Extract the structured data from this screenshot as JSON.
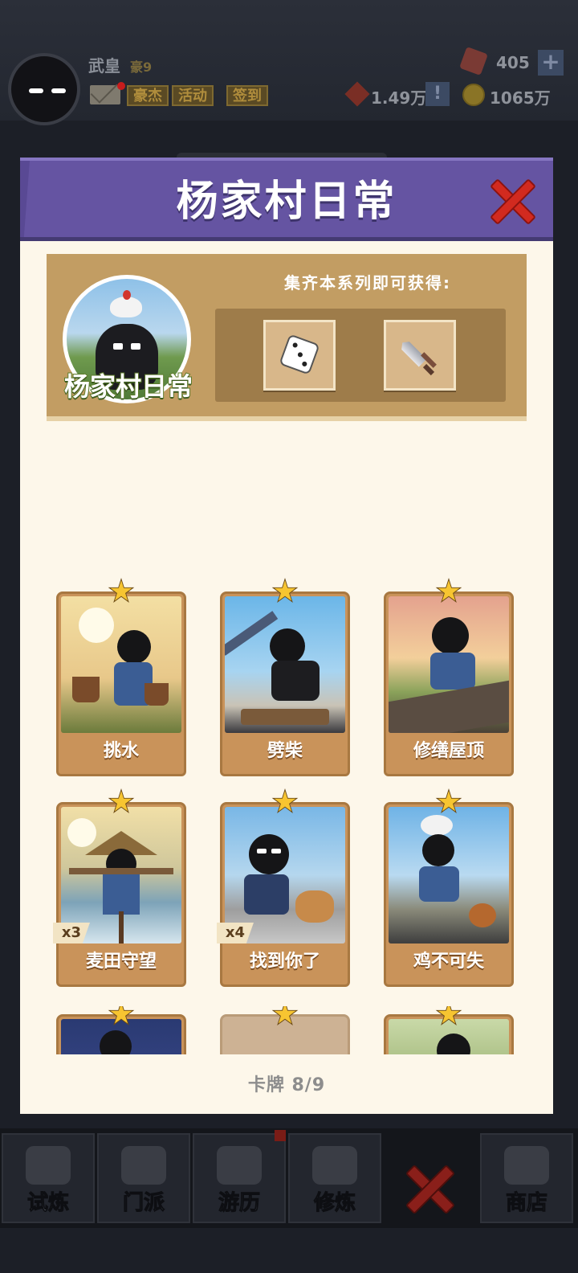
{
  "hud": {
    "player_name": "武皇",
    "player_rank": "豪9",
    "buttons": [
      "豪杰",
      "活动",
      "签到"
    ],
    "gems": "405",
    "plus": "+",
    "tokens": "1.49万",
    "alert": "!",
    "gold": "1065万"
  },
  "modal": {
    "title": "杨家村日常",
    "series_name": "杨家村日常",
    "reward_caption": "集齐本系列即可获得:",
    "rewards": [
      {
        "icon": "dice-icon"
      },
      {
        "icon": "sword-icon"
      }
    ],
    "cards": [
      {
        "name": "挑水",
        "count": ""
      },
      {
        "name": "劈柴",
        "count": ""
      },
      {
        "name": "修缮屋顶",
        "count": ""
      },
      {
        "name": "麦田守望",
        "count": "x3"
      },
      {
        "name": "找到你了",
        "count": "x4"
      },
      {
        "name": "鸡不可失",
        "count": ""
      },
      {
        "name": "",
        "count": ""
      },
      {
        "name": "",
        "count": ""
      },
      {
        "name": "",
        "count": ""
      }
    ],
    "counter": "卡牌  8/9"
  },
  "nav": {
    "items": [
      "试炼",
      "门派",
      "游历",
      "修炼",
      "",
      "商店"
    ]
  },
  "colors": {
    "header_purple": "#6554a2",
    "close_red": "#d22a1f",
    "panel_tan": "#c29d63",
    "card_tan": "#c9935a",
    "star_gold": "#f7c531",
    "modal_bg": "#fdf7ea"
  }
}
